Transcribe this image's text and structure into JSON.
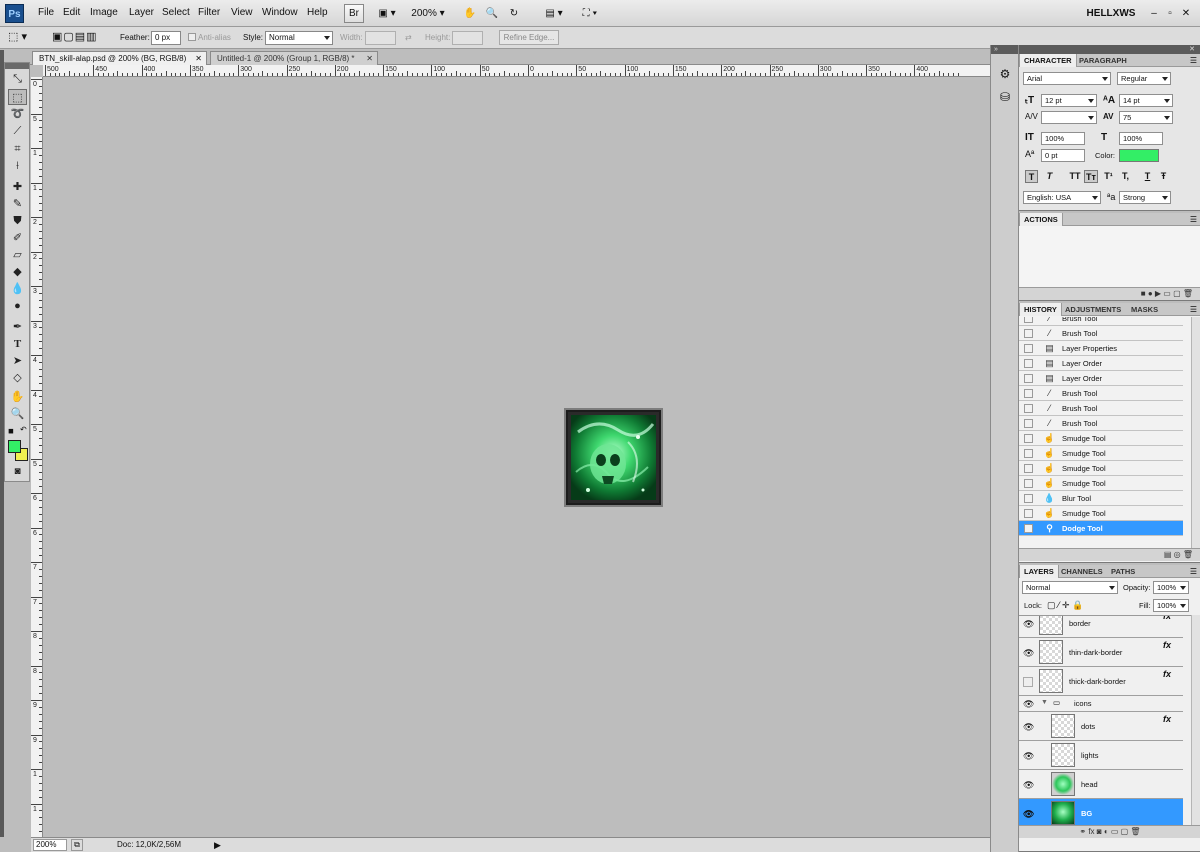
{
  "app": {
    "logo": "Ps",
    "user": "HELLXWS",
    "zoom": "200%",
    "bridge": "Br"
  },
  "menu": [
    "File",
    "Edit",
    "Image",
    "Layer",
    "Select",
    "Filter",
    "View",
    "Window",
    "Help"
  ],
  "options": {
    "feather_label": "Feather:",
    "feather_value": "0 px",
    "antialias_label": "Anti-alias",
    "style_label": "Style:",
    "style_value": "Normal",
    "width_label": "Width:",
    "height_label": "Height:",
    "refine_label": "Refine Edge..."
  },
  "tabs": [
    {
      "label": "BTN_skill-alap.psd @ 200% (BG, RGB/8)",
      "active": true
    },
    {
      "label": "Untitled-1 @ 200% (Group 1, RGB/8) *",
      "active": false
    }
  ],
  "ruler_h": [
    "500",
    "450",
    "400",
    "350",
    "300",
    "250",
    "200",
    "150",
    "100",
    "50",
    "0",
    "50",
    "100",
    "150",
    "200",
    "250",
    "300",
    "350",
    "400"
  ],
  "ruler_v": [
    "0",
    "5",
    "1",
    "1",
    "2",
    "2",
    "3",
    "3",
    "4",
    "4",
    "5",
    "5",
    "6",
    "6",
    "7",
    "7",
    "8",
    "8",
    "9",
    "9",
    "1",
    "1"
  ],
  "status": {
    "zoom": "200%",
    "doc": "Doc: 12,0K/2,56M"
  },
  "character": {
    "tabs": [
      "CHARACTER",
      "PARAGRAPH"
    ],
    "font_family": "Arial",
    "font_style": "Regular",
    "size": "12 pt",
    "leading": "14 pt",
    "kerning": "",
    "tracking": "75",
    "vscale": "100%",
    "hscale": "100%",
    "baseline": "0 pt",
    "color_label": "Color:",
    "color": "#33ee66",
    "language": "English: USA",
    "aa_label": "a",
    "antialias": "Strong",
    "type_buttons": [
      "T",
      "T",
      "TT",
      "Tт",
      "T¹",
      "T,",
      "T",
      "Ŧ"
    ]
  },
  "actions": {
    "tabs": [
      "ACTIONS"
    ]
  },
  "history": {
    "tabs": [
      "HISTORY",
      "ADJUSTMENTS",
      "MASKS"
    ],
    "items": [
      {
        "label": "Brush Tool",
        "icon": "brush-icon"
      },
      {
        "label": "Brush Tool",
        "icon": "brush-icon"
      },
      {
        "label": "Layer Properties",
        "icon": "doc-icon"
      },
      {
        "label": "Layer Order",
        "icon": "doc-icon"
      },
      {
        "label": "Layer Order",
        "icon": "doc-icon"
      },
      {
        "label": "Brush Tool",
        "icon": "brush-icon"
      },
      {
        "label": "Brush Tool",
        "icon": "brush-icon"
      },
      {
        "label": "Brush Tool",
        "icon": "brush-icon"
      },
      {
        "label": "Smudge Tool",
        "icon": "smudge-icon"
      },
      {
        "label": "Smudge Tool",
        "icon": "smudge-icon"
      },
      {
        "label": "Smudge Tool",
        "icon": "smudge-icon"
      },
      {
        "label": "Smudge Tool",
        "icon": "smudge-icon"
      },
      {
        "label": "Blur Tool",
        "icon": "blur-icon"
      },
      {
        "label": "Smudge Tool",
        "icon": "smudge-icon"
      },
      {
        "label": "Dodge Tool",
        "icon": "dodge-icon",
        "selected": true
      }
    ]
  },
  "layers": {
    "tabs": [
      "LAYERS",
      "CHANNELS",
      "PATHS"
    ],
    "blend": "Normal",
    "opacity_label": "Opacity:",
    "opacity": "100%",
    "lock_label": "Lock:",
    "fill_label": "Fill:",
    "fill": "100%",
    "items": [
      {
        "name": "border",
        "fx": true,
        "visible": true
      },
      {
        "name": "thin-dark-border",
        "fx": true,
        "visible": true
      },
      {
        "name": "thick-dark-border",
        "fx": true,
        "visible": false
      },
      {
        "name": "icons",
        "group": true,
        "visible": true
      },
      {
        "name": "dots",
        "fx": true,
        "visible": true
      },
      {
        "name": "lights",
        "fx": false,
        "visible": true
      },
      {
        "name": "head",
        "fx": false,
        "visible": true
      },
      {
        "name": "BG",
        "fx": false,
        "visible": true,
        "selected": true
      }
    ]
  },
  "colors": {
    "foreground": "#33ee66",
    "background": "#f0f050",
    "selection": "#3399ff"
  }
}
